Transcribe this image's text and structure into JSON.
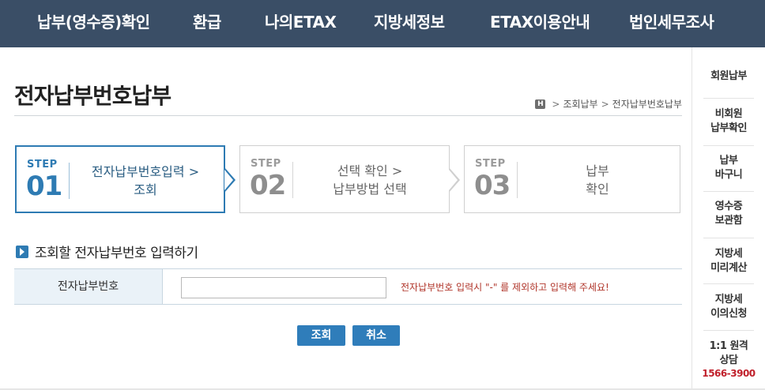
{
  "top_nav": {
    "items": [
      "납부(영수증)확인",
      "환급",
      "나의ETAX",
      "지방세정보",
      "ETAX이용안내",
      "법인세무조사"
    ]
  },
  "page": {
    "title": "전자납부번호납부"
  },
  "breadcrumb": {
    "home_icon": "H",
    "items": [
      "조회납부",
      "전자납부번호납부"
    ]
  },
  "steps": [
    {
      "word": "STEP",
      "number": "01",
      "line1": "전자납부번호입력 >",
      "line2": "조회",
      "active": true
    },
    {
      "word": "STEP",
      "number": "02",
      "line1": "선택 확인 >",
      "line2": "납부방법 선택",
      "active": false
    },
    {
      "word": "STEP",
      "number": "03",
      "line1": "납부",
      "line2": "확인",
      "active": false
    }
  ],
  "section": {
    "title": "조회할 전자납부번호 입력하기"
  },
  "form": {
    "label": "전자납부번호",
    "value": "",
    "placeholder": "",
    "hint": "전자납부번호 입력시 \"-\" 를 제외하고 입력해 주세요!"
  },
  "buttons": {
    "search": "조회",
    "cancel": "취소"
  },
  "quick_menu": {
    "items": [
      {
        "line1": "회원납부",
        "line2": ""
      },
      {
        "line1": "비회원",
        "line2": "납부확인"
      },
      {
        "line1": "납부",
        "line2": "바구니"
      },
      {
        "line1": "영수증",
        "line2": "보관함"
      },
      {
        "line1": "지방세",
        "line2": "미리계산"
      },
      {
        "line1": "지방세",
        "line2": "이의신청"
      },
      {
        "line1": "1:1 원격",
        "line2": "상담"
      }
    ],
    "phone": "1566-3900"
  },
  "colors": {
    "nav_bg": "#3a4e66",
    "accent": "#2e7bb3",
    "hint": "#b0352a",
    "phone": "#c0202b"
  }
}
